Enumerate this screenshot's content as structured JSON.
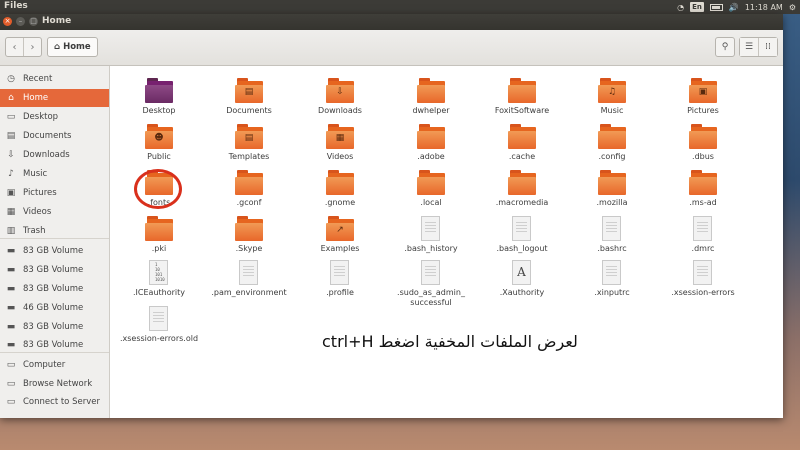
{
  "top_panel": {
    "app_name": "Files",
    "wifi_icon": "wifi-icon",
    "language": "En",
    "battery_icon": "battery-icon",
    "volume_icon": "volume-icon",
    "volume_glyph": "🔊",
    "wifi_glyph": "◔",
    "time": "11:18 AM",
    "settings_icon": "gear-icon",
    "settings_glyph": "⚙"
  },
  "window": {
    "title": "Home",
    "close_glyph": "×",
    "min_glyph": "–",
    "max_glyph": "□"
  },
  "toolbar": {
    "back_glyph": "‹",
    "forward_glyph": "›",
    "path_home_label": "Home",
    "home_glyph": "⌂",
    "search_glyph": "⚲",
    "list_view_glyph": "☰",
    "grid_view_glyph": "⁞⁞"
  },
  "sidebar": {
    "items": [
      {
        "label": "Recent",
        "icon": "clock-icon",
        "glyph": "◷"
      },
      {
        "label": "Home",
        "icon": "home-icon",
        "glyph": "⌂",
        "active": true
      },
      {
        "label": "Desktop",
        "icon": "desktop-icon",
        "glyph": "▭"
      },
      {
        "label": "Documents",
        "icon": "documents-icon",
        "glyph": "▤"
      },
      {
        "label": "Downloads",
        "icon": "downloads-icon",
        "glyph": "⇩"
      },
      {
        "label": "Music",
        "icon": "music-icon",
        "glyph": "♪"
      },
      {
        "label": "Pictures",
        "icon": "pictures-icon",
        "glyph": "▣"
      },
      {
        "label": "Videos",
        "icon": "videos-icon",
        "glyph": "▦"
      },
      {
        "label": "Trash",
        "icon": "trash-icon",
        "glyph": "▥"
      },
      {
        "label": "83 GB Volume",
        "icon": "drive-icon",
        "glyph": "▬"
      },
      {
        "label": "83 GB Volume",
        "icon": "drive-icon",
        "glyph": "▬"
      },
      {
        "label": "83 GB Volume",
        "icon": "drive-icon",
        "glyph": "▬"
      },
      {
        "label": "46 GB Volume",
        "icon": "drive-icon",
        "glyph": "▬"
      },
      {
        "label": "83 GB Volume",
        "icon": "drive-icon",
        "glyph": "▬"
      },
      {
        "label": "83 GB Volume",
        "icon": "drive-icon",
        "glyph": "▬"
      },
      {
        "label": "Computer",
        "icon": "computer-icon",
        "glyph": "▭"
      },
      {
        "label": "Browse Network",
        "icon": "network-icon",
        "glyph": "▭"
      },
      {
        "label": "Connect to Server",
        "icon": "server-icon",
        "glyph": "▭"
      }
    ]
  },
  "files": [
    {
      "name": "Desktop",
      "kind": "desktop"
    },
    {
      "name": "Documents",
      "kind": "folder",
      "emblem": "▤"
    },
    {
      "name": "Downloads",
      "kind": "folder",
      "emblem": "⇩"
    },
    {
      "name": "dwhelper",
      "kind": "folder"
    },
    {
      "name": "FoxitSoftware",
      "kind": "folder"
    },
    {
      "name": "Music",
      "kind": "folder",
      "emblem": "♫"
    },
    {
      "name": "Pictures",
      "kind": "folder",
      "emblem": "▣"
    },
    {
      "name": "Public",
      "kind": "folder",
      "emblem": "☻"
    },
    {
      "name": "Templates",
      "kind": "folder",
      "emblem": "▤"
    },
    {
      "name": "Videos",
      "kind": "folder",
      "emblem": "▦"
    },
    {
      "name": ".adobe",
      "kind": "folder"
    },
    {
      "name": ".cache",
      "kind": "folder"
    },
    {
      "name": ".config",
      "kind": "folder"
    },
    {
      "name": ".dbus",
      "kind": "folder"
    },
    {
      "name": ".fonts",
      "kind": "folder"
    },
    {
      "name": ".gconf",
      "kind": "folder"
    },
    {
      "name": ".gnome",
      "kind": "folder"
    },
    {
      "name": ".local",
      "kind": "folder"
    },
    {
      "name": ".macromedia",
      "kind": "folder"
    },
    {
      "name": ".mozilla",
      "kind": "folder"
    },
    {
      "name": ".ms-ad",
      "kind": "folder"
    },
    {
      "name": ".pki",
      "kind": "folder"
    },
    {
      "name": ".Skype",
      "kind": "folder"
    },
    {
      "name": "Examples",
      "kind": "folder",
      "emblem": "↗"
    },
    {
      "name": ".bash_history",
      "kind": "doc"
    },
    {
      "name": ".bash_logout",
      "kind": "doc"
    },
    {
      "name": ".bashrc",
      "kind": "doc"
    },
    {
      "name": ".dmrc",
      "kind": "doc"
    },
    {
      "name": ".ICEauthority",
      "kind": "binary",
      "preview": "1\n10\n101\n1010"
    },
    {
      "name": ".pam_environment",
      "kind": "doc"
    },
    {
      "name": ".profile",
      "kind": "doc"
    },
    {
      "name": ".sudo_as_admin_\nsuccessful",
      "kind": "doc"
    },
    {
      "name": ".Xauthority",
      "kind": "font",
      "glyph": "A"
    },
    {
      "name": ".xinputrc",
      "kind": "doc"
    },
    {
      "name": ".xsession-errors",
      "kind": "doc"
    },
    {
      "name": ".xsession-errors.old",
      "kind": "doc"
    }
  ],
  "annotation": {
    "note": "لعرض الملفات المخفية اضغط ctrl+H",
    "highlight_color": "#d9301c"
  },
  "colors": {
    "accent": "#e5683a",
    "folder": "#e8672a"
  }
}
